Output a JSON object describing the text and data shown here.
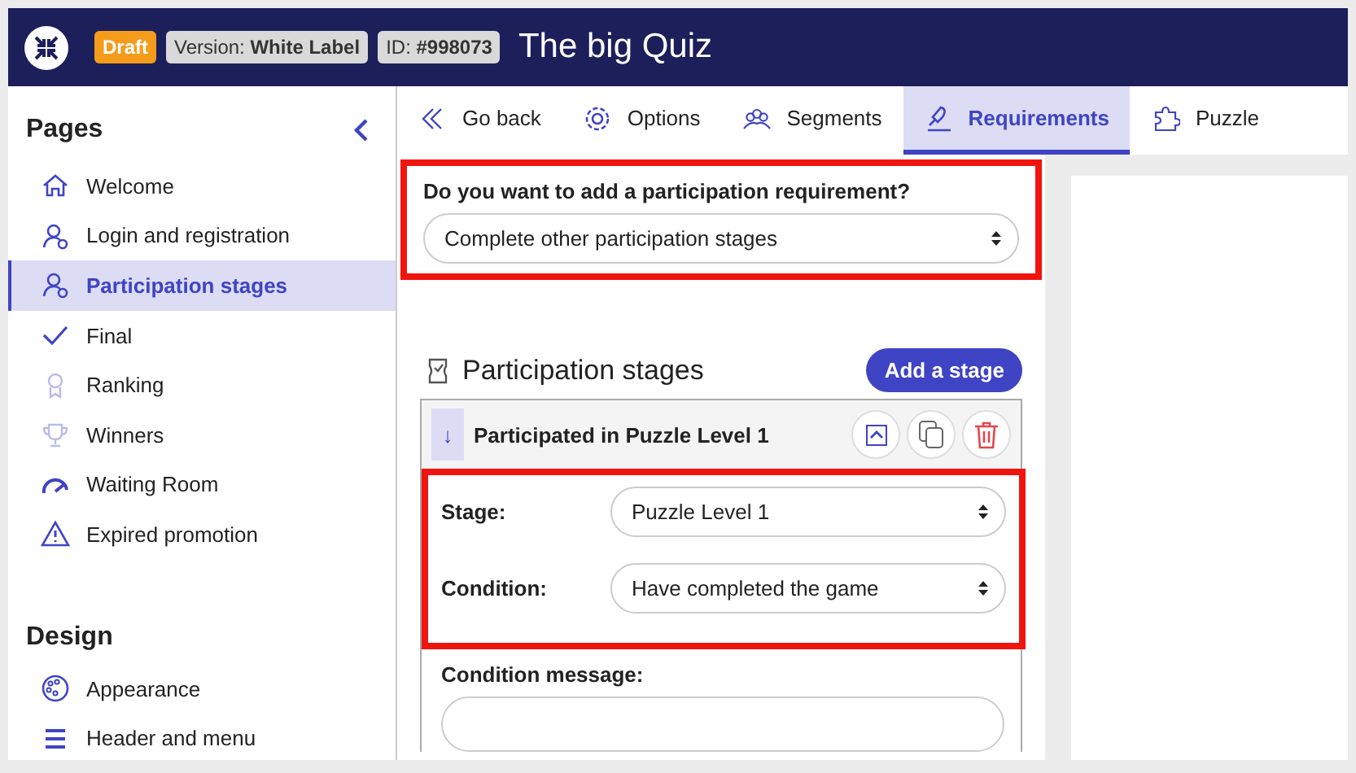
{
  "header": {
    "status_badge": "Draft",
    "version": "Version: **White Label**",
    "id": "ID: **#998073**",
    "title": "The big Quiz"
  },
  "sidebar": {
    "sections": [
      {
        "title": "Pages",
        "items": [
          {
            "label": "Welcome",
            "selected": false
          },
          {
            "label": "Login and registration",
            "selected": false
          },
          {
            "label": "Participation stages",
            "selected": true
          },
          {
            "label": "Final",
            "selected": false
          },
          {
            "label": "Ranking",
            "selected": false
          },
          {
            "label": "Winners",
            "selected": false
          },
          {
            "label": "Waiting Room",
            "selected": false
          },
          {
            "label": "Expired promotion",
            "selected": false
          }
        ]
      },
      {
        "title": "Design",
        "items": [
          {
            "label": "Appearance",
            "selected": false
          },
          {
            "label": "Header and menu",
            "selected": false
          }
        ]
      }
    ]
  },
  "tabs": [
    {
      "label": "Go back",
      "selected": false
    },
    {
      "label": "Options",
      "selected": false
    },
    {
      "label": "Segments",
      "selected": false
    },
    {
      "label": "Requirements",
      "selected": true
    },
    {
      "label": "Puzzle",
      "selected": false
    }
  ],
  "requirement": {
    "question": "Do you want to add a participation requirement?",
    "value": "Complete other participation stages",
    "highlighted": true
  },
  "stages": {
    "title": "Participation stages",
    "add_button": "Add a stage",
    "items": [
      {
        "handle": "↓",
        "title": "Participated in Puzzle Level 1",
        "fields_highlighted": true,
        "stage_label": "Stage:",
        "stage_value": "Puzzle Level 1",
        "condition_label": "Condition:",
        "condition_value": "Have completed the game",
        "message_label": "Condition message:"
      }
    ]
  }
}
